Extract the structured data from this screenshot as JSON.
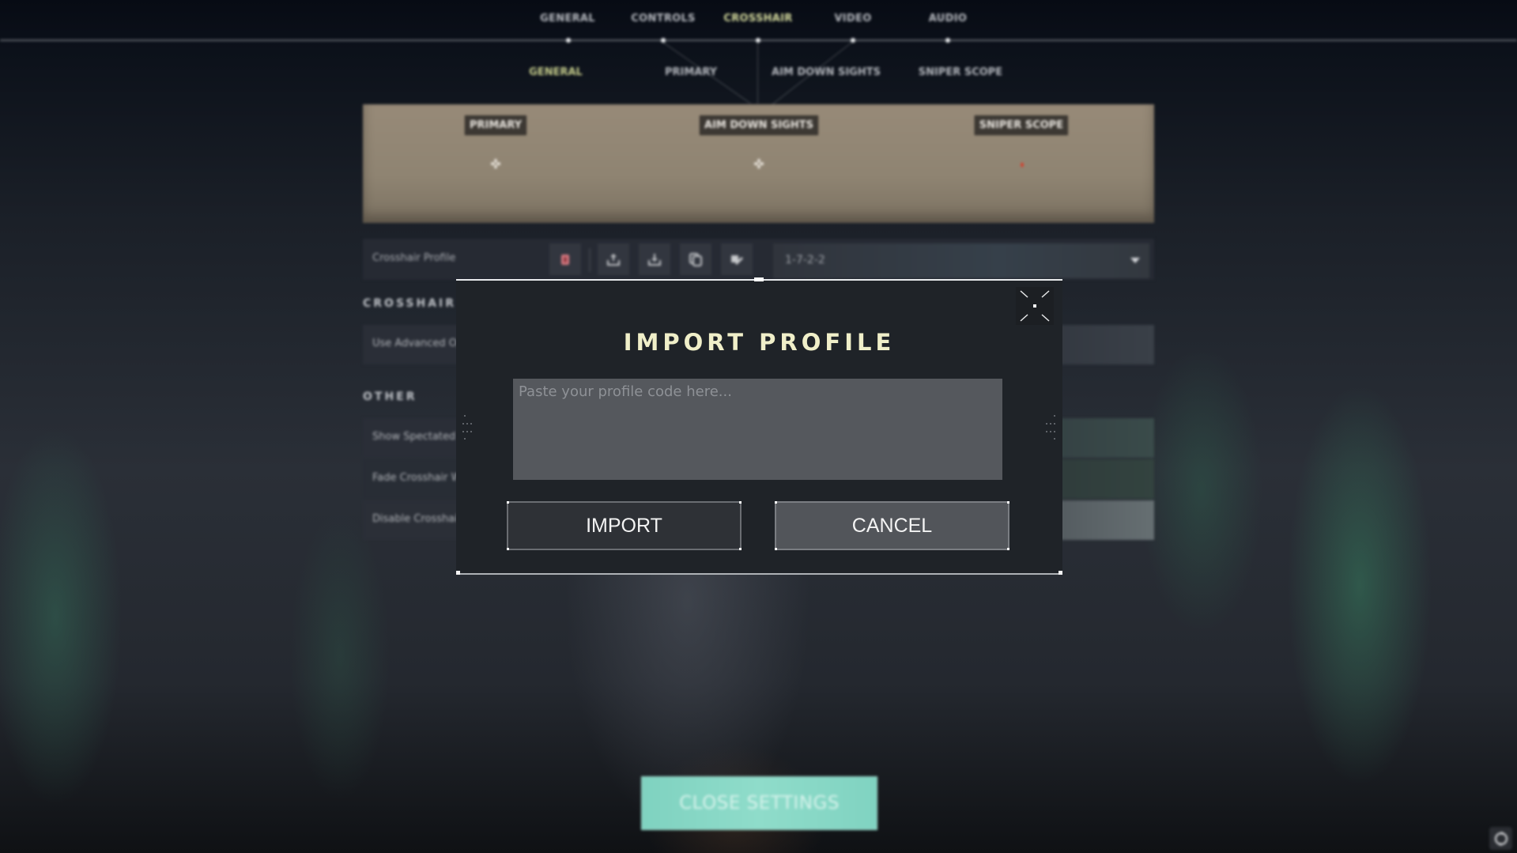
{
  "top_tabs": [
    {
      "label": "GENERAL",
      "active": false
    },
    {
      "label": "CONTROLS",
      "active": false
    },
    {
      "label": "CROSSHAIR",
      "active": true
    },
    {
      "label": "VIDEO",
      "active": false
    },
    {
      "label": "AUDIO",
      "active": false
    }
  ],
  "sub_tabs": [
    {
      "label": "GENERAL",
      "active": true
    },
    {
      "label": "PRIMARY",
      "active": false
    },
    {
      "label": "AIM DOWN SIGHTS",
      "active": false
    },
    {
      "label": "SNIPER SCOPE",
      "active": false
    }
  ],
  "preview": {
    "labels": [
      "PRIMARY",
      "AIM DOWN SIGHTS",
      "SNIPER SCOPE"
    ],
    "sniper_dot_color": "#e0321f"
  },
  "profile": {
    "label": "Crosshair Profile",
    "actions": [
      "trash-icon",
      "upload-icon",
      "download-icon",
      "copy-icon",
      "rename-icon"
    ],
    "selected": "1-7-2-2"
  },
  "sections": {
    "crosshair": {
      "header": "CROSSHAIR",
      "rows": [
        "Use Advanced Options"
      ]
    },
    "other": {
      "header": "OTHER",
      "rows": [
        "Show Spectated Player's Crosshair",
        "Fade Crosshair With Firing Error",
        "Disable Crosshair"
      ]
    }
  },
  "modal": {
    "title": "IMPORT PROFILE",
    "input_placeholder": "Paste your profile code here...",
    "input_value": "",
    "import_label": "IMPORT",
    "cancel_label": "CANCEL",
    "title_color": "#f0efc9"
  },
  "footer": {
    "close_settings_label": "CLOSE SETTINGS",
    "accent_color": "#8fdcca"
  }
}
